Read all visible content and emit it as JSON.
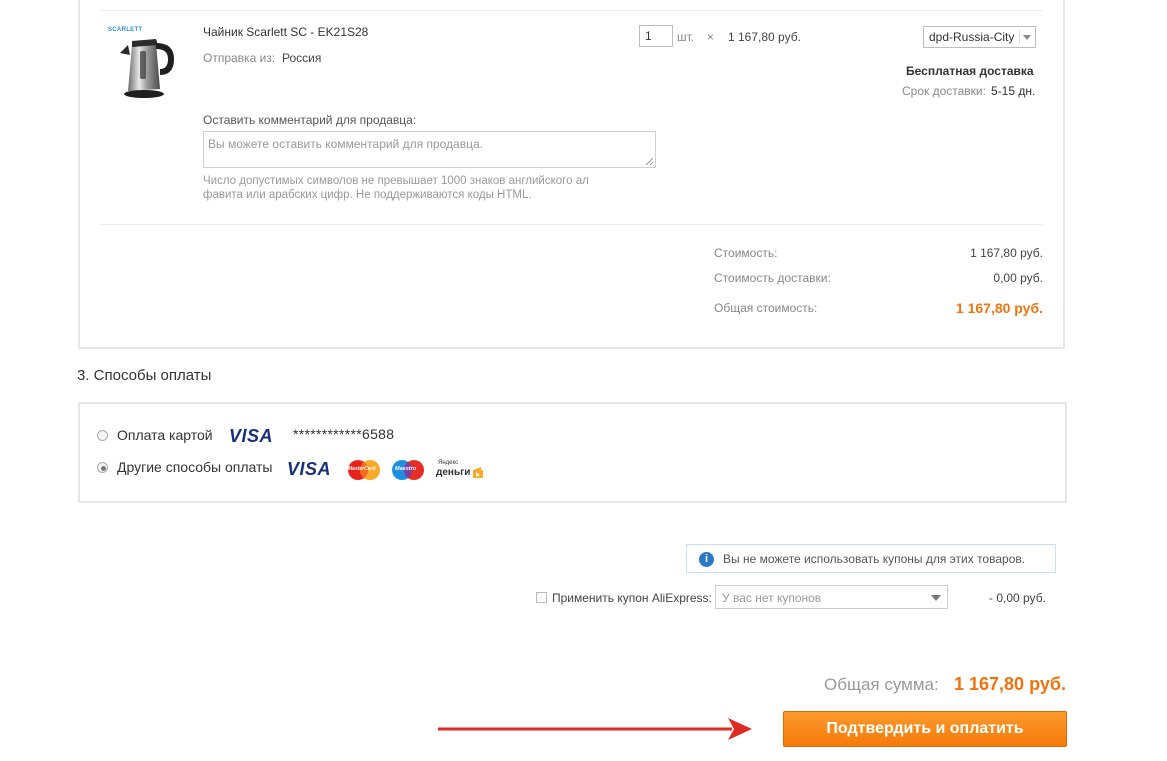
{
  "product": {
    "brand_logo": "SCARLETT",
    "name": "Чайник Scarlett SC - EK21S28",
    "ship_from_label": "Отправка из:",
    "ship_from_value": "Россия",
    "quantity": "1",
    "unit": "шт.",
    "times": "×",
    "price": "1 167,80 руб.",
    "shipping_method": "dpd-Russia-City",
    "free_delivery": "Бесплатная доставка",
    "delivery_time_label": "Срок доставки:",
    "delivery_time_value": "5-15 дн.",
    "comment_label": "Оставить комментарий для продавца:",
    "comment_placeholder": "Вы можете оставить комментарий для продавца.",
    "comment_hint_1": "Число допустимых символов не превышает 1000 знаков английского ал",
    "comment_hint_2": "фавита или арабских цифр. Не поддерживаются коды HTML."
  },
  "totals": {
    "cost_label": "Стоимость:",
    "cost_value": "1 167,80 руб.",
    "shipping_label": "Стоимость доставки:",
    "shipping_value": "0,00 руб.",
    "total_label": "Общая стоимость:",
    "total_value": "1 167,80 руб."
  },
  "payment": {
    "section_title": "3. Способы оплаты",
    "option_card_label": "Оплата картой",
    "card_brand": "VISA",
    "card_number": "************6588",
    "option_other_label": "Другие способы оплаты",
    "other_visa": "VISA",
    "mastercard_text": "MasterCard",
    "maestro_text": "Maestro",
    "yandex_top": "Яндекс",
    "yandex_bottom": "деньги",
    "selected": "other"
  },
  "coupon": {
    "notice": "Вы не можете использовать купоны для этих товаров.",
    "apply_label": "Применить купон AliExpress:",
    "select_value": "У вас нет купонов",
    "discount": "- 0,00 руб."
  },
  "summary": {
    "total_label": "Общая сумма:",
    "total_value": "1 167,80 руб.",
    "confirm_button": "Подтвердить и оплатить"
  },
  "colors": {
    "accent_orange": "#f0740e",
    "arrow_red": "#e02a24",
    "info_blue": "#2a79c4"
  }
}
